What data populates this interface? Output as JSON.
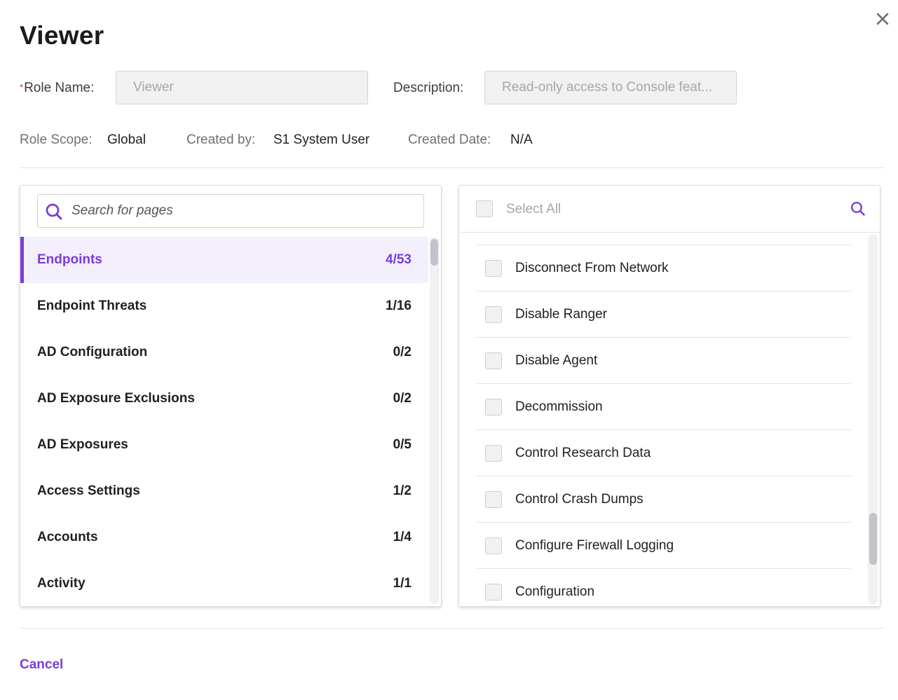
{
  "dialog": {
    "title": "Viewer",
    "close_icon": "close-icon"
  },
  "form": {
    "role_name_required_mark": "*",
    "role_name_label": "Role Name:",
    "role_name_value": "Viewer",
    "description_label": "Description:",
    "description_value": "Read-only access to Console feat..."
  },
  "meta": {
    "role_scope_label": "Role Scope:",
    "role_scope_value": "Global",
    "created_by_label": "Created by:",
    "created_by_value": "S1 System User",
    "created_date_label": "Created Date:",
    "created_date_value": "N/A"
  },
  "left_panel": {
    "search_placeholder": "Search for pages",
    "search_icon": "search-icon",
    "categories": [
      {
        "name": "Endpoints",
        "count": "4/53",
        "active": true
      },
      {
        "name": "Endpoint Threats",
        "count": "1/16"
      },
      {
        "name": "AD Configuration",
        "count": "0/2"
      },
      {
        "name": "AD Exposure Exclusions",
        "count": "0/2"
      },
      {
        "name": "AD Exposures",
        "count": "0/5"
      },
      {
        "name": "Access Settings",
        "count": "1/2"
      },
      {
        "name": "Accounts",
        "count": "1/4"
      },
      {
        "name": "Activity",
        "count": "1/1"
      }
    ]
  },
  "right_panel": {
    "select_all_label": "Select All",
    "search_icon": "search-icon",
    "permissions": [
      {
        "label": "Disconnect From Network",
        "checked": false
      },
      {
        "label": "Disable Ranger",
        "checked": false
      },
      {
        "label": "Disable Agent",
        "checked": false
      },
      {
        "label": "Decommission",
        "checked": false
      },
      {
        "label": "Control Research Data",
        "checked": false
      },
      {
        "label": "Control Crash Dumps",
        "checked": false
      },
      {
        "label": "Configure Firewall Logging",
        "checked": false
      },
      {
        "label": "Configuration",
        "checked": false
      }
    ]
  },
  "footer": {
    "cancel_label": "Cancel"
  },
  "colors": {
    "accent": "#7a3ddb",
    "required": "#d3263b",
    "active_bg": "#f3effd"
  }
}
